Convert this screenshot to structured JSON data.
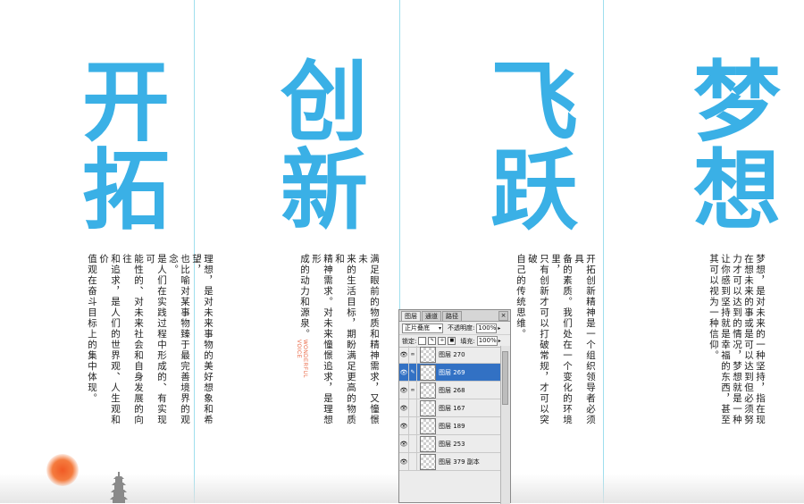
{
  "columns": [
    {
      "title": [
        "开",
        "拓"
      ],
      "body": [
        "理想，是对未来事物的美好想象和希望，",
        "也比喻对某事物臻于最完善境界的观念。",
        "是人们在实践过程中形成的、有实现可",
        "能性的、对未来社会和自身发展的向往",
        "和追求，是人们的世界观、人生观和价",
        "值观在奋斗目标上的集中体现。"
      ]
    },
    {
      "title": [
        "创",
        "新"
      ],
      "body": [
        "满足眼前的物质和精神需求，又憧憬未",
        "来的生活目标，期盼满足更高的物质和",
        "精神需求。对未来憧憬追求，是理想形",
        "成的动力和源泉。"
      ],
      "voice": [
        "WONDERFUL",
        "VOICE"
      ]
    },
    {
      "title": [
        "飞",
        "跃"
      ],
      "body": [
        "开拓创新精神是一个组织领导者必须具",
        "备的素质。我们处在一个变化的环境里，",
        "只有创新才可以打破常规，才可以突破",
        "自己的传统思维。"
      ]
    },
    {
      "title": [
        "梦",
        "想"
      ],
      "body": [
        "梦想，是对未来的一种坚持，指在现",
        "在想未来的事或是可以达到但必须努",
        "力才可以达到的情况，梦想就是一种",
        "让你感到坚持就是幸福的东西，甚至",
        "其可以视为一种信仰。"
      ]
    }
  ],
  "colors": {
    "title": "#3ab0e6",
    "guide": "#9fdfee",
    "selection": "#3271c4"
  },
  "layers_panel": {
    "tabs": [
      "图层",
      "通道",
      "路径"
    ],
    "close_label": "×",
    "blend_mode": "正片叠底",
    "opacity_label": "不透明度:",
    "opacity_value": "100%",
    "lock_label": "锁定:",
    "fill_label": "填充:",
    "fill_value": "100%",
    "layers": [
      {
        "name": "图层 270",
        "selected": false,
        "icon": "chain-icon"
      },
      {
        "name": "图层 269",
        "selected": true,
        "icon": "brush-icon"
      },
      {
        "name": "图层 268",
        "selected": false,
        "icon": "chain-icon"
      },
      {
        "name": "图层 167",
        "selected": false,
        "icon": ""
      },
      {
        "name": "图层 189",
        "selected": false,
        "icon": ""
      },
      {
        "name": "图层 253",
        "selected": false,
        "icon": ""
      },
      {
        "name": "图层 379 副本",
        "selected": false,
        "icon": ""
      }
    ]
  }
}
